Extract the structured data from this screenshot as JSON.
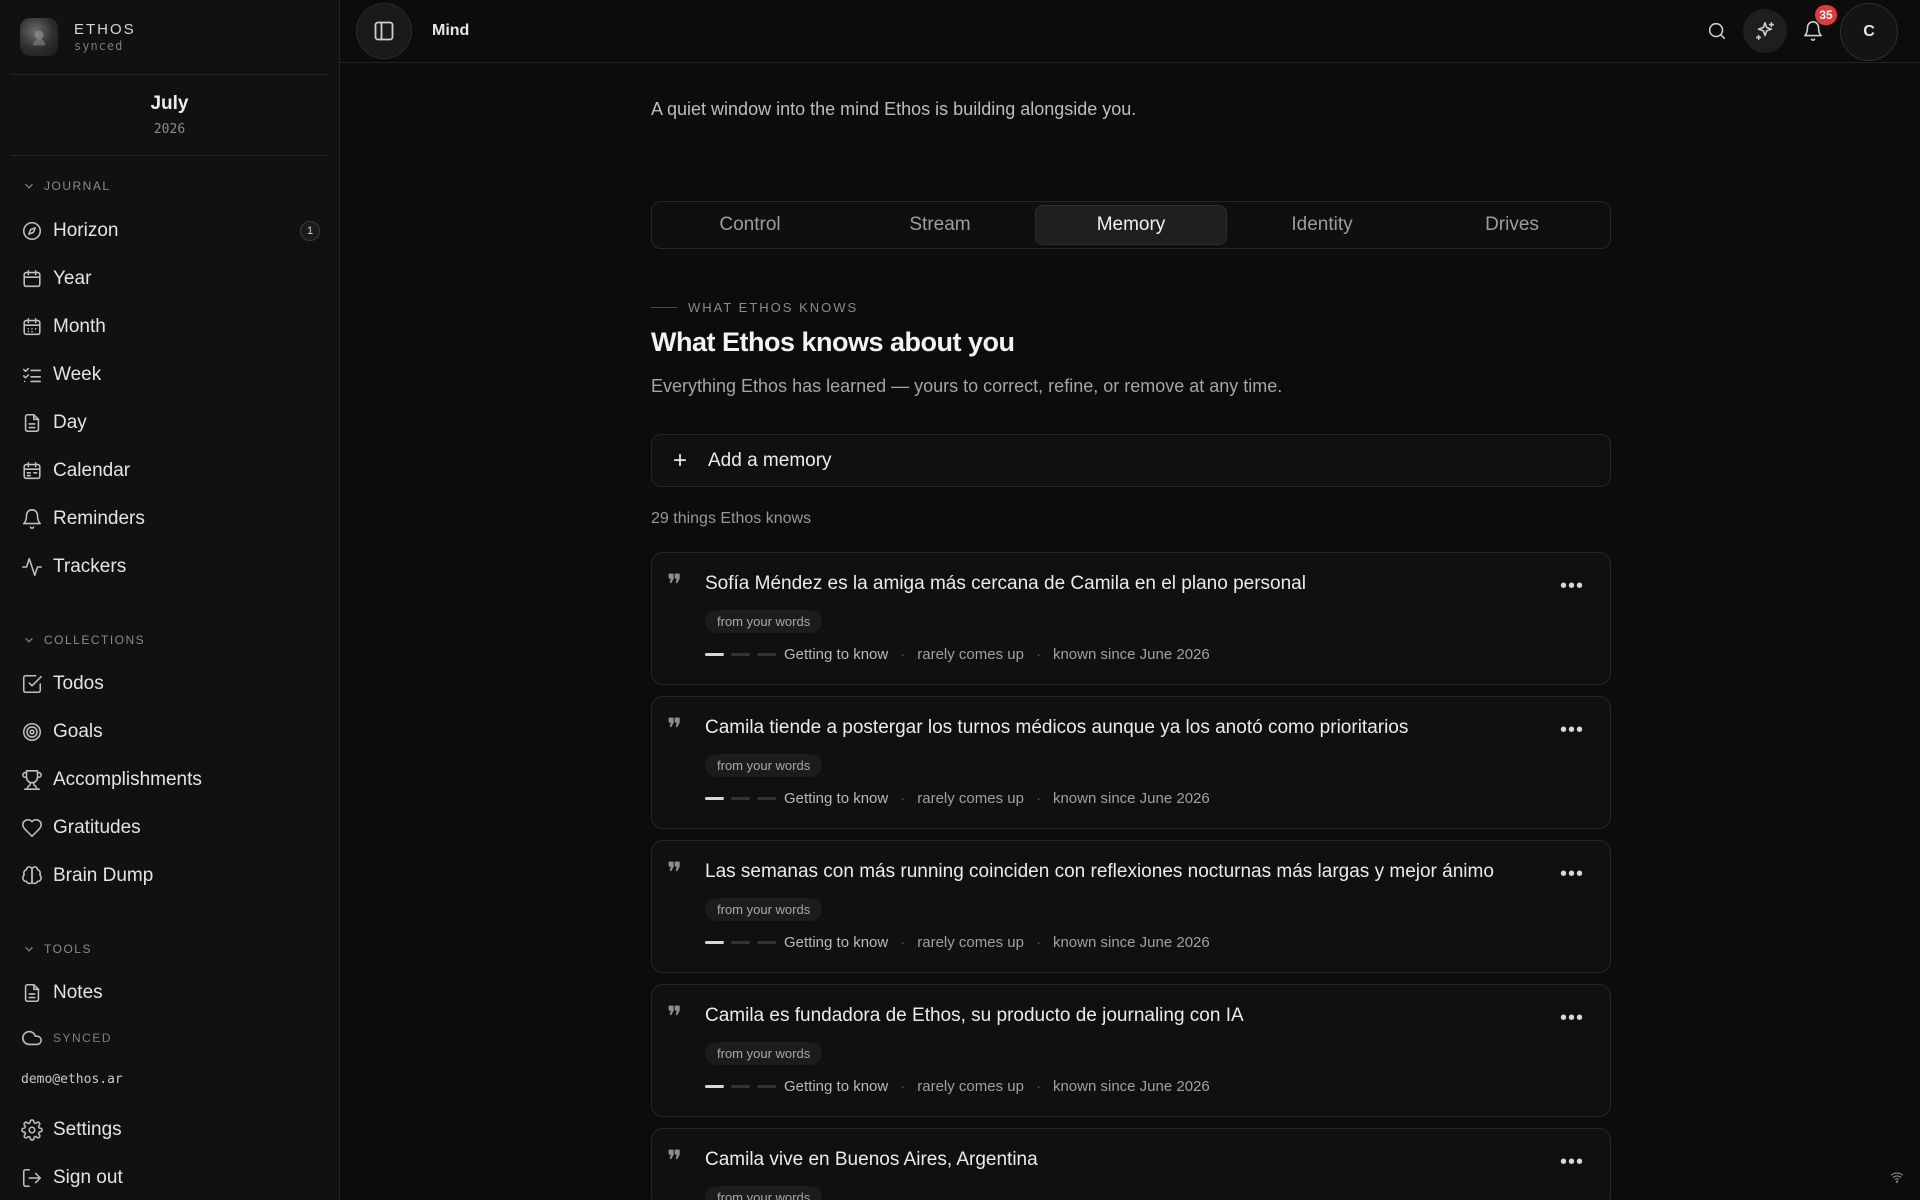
{
  "brand": {
    "name": "ETHOS",
    "status": "synced"
  },
  "calendar": {
    "month": "July",
    "year": "2026"
  },
  "sidebar": {
    "journal_label": "JOURNAL",
    "journal_items": [
      {
        "label": "Horizon",
        "icon": "compass-icon",
        "badge": "1"
      },
      {
        "label": "Year",
        "icon": "calendar-icon"
      },
      {
        "label": "Month",
        "icon": "calendar-grid-icon"
      },
      {
        "label": "Week",
        "icon": "list-checks-icon"
      },
      {
        "label": "Day",
        "icon": "document-icon"
      },
      {
        "label": "Calendar",
        "icon": "calendar-days-icon"
      },
      {
        "label": "Reminders",
        "icon": "bell-icon"
      },
      {
        "label": "Trackers",
        "icon": "activity-icon"
      }
    ],
    "collections_label": "COLLECTIONS",
    "collection_items": [
      {
        "label": "Todos",
        "icon": "checkbox-icon"
      },
      {
        "label": "Goals",
        "icon": "target-icon"
      },
      {
        "label": "Accomplishments",
        "icon": "trophy-icon"
      },
      {
        "label": "Gratitudes",
        "icon": "heart-icon"
      },
      {
        "label": "Brain Dump",
        "icon": "brain-icon"
      }
    ],
    "tools_label": "TOOLS",
    "tool_items": [
      {
        "label": "Notes",
        "icon": "document-icon"
      }
    ],
    "sync_status": "SYNCED",
    "email": "demo@ethos.ar",
    "settings_label": "Settings",
    "signout_label": "Sign out"
  },
  "topbar": {
    "title": "Mind",
    "notification_count": "35",
    "avatar_initial": "C"
  },
  "main": {
    "intro": "A quiet window into the mind Ethos is building alongside you.",
    "tabs": [
      "Control",
      "Stream",
      "Memory",
      "Identity",
      "Drives"
    ],
    "active_tab": "Memory",
    "eyebrow": "WHAT ETHOS KNOWS",
    "heading": "What Ethos knows about you",
    "subheading": "Everything Ethos has learned — yours to correct, refine, or remove at any time.",
    "add_label": "Add a memory",
    "count_label": "29 things Ethos knows",
    "memories": [
      {
        "text": "Sofía Méndez es la amiga más cercana de Camila en el plano personal",
        "tag": "from your words",
        "confidence": "Getting to know",
        "confidence_level": 1,
        "frequency": "rarely comes up",
        "since": "known since June 2026"
      },
      {
        "text": "Camila tiende a postergar los turnos médicos aunque ya los anotó como prioritarios",
        "tag": "from your words",
        "confidence": "Getting to know",
        "confidence_level": 1,
        "frequency": "rarely comes up",
        "since": "known since June 2026"
      },
      {
        "text": "Las semanas con más running coinciden con reflexiones nocturnas más largas y mejor ánimo",
        "tag": "from your words",
        "confidence": "Getting to know",
        "confidence_level": 1,
        "frequency": "rarely comes up",
        "since": "known since June 2026"
      },
      {
        "text": "Camila es fundadora de Ethos, su producto de journaling con IA",
        "tag": "from your words",
        "confidence": "Getting to know",
        "confidence_level": 1,
        "frequency": "rarely comes up",
        "since": "known since June 2026"
      },
      {
        "text": "Camila vive en Buenos Aires, Argentina",
        "tag": "from your words"
      }
    ]
  },
  "colors": {
    "background": "#0c0c0d",
    "sidebar": "#111112",
    "badge": "#e03a3a"
  }
}
